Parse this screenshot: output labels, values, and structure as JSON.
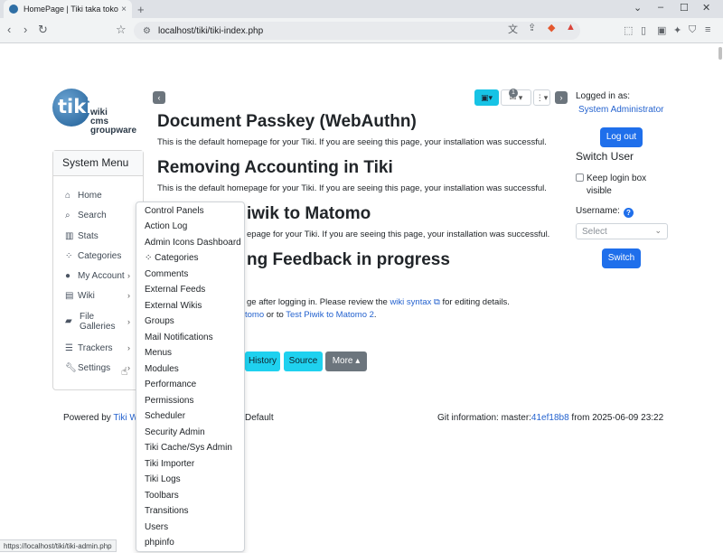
{
  "browser": {
    "tab_title": "HomePage | Tiki taka toko",
    "tab_close": "×",
    "new_tab": "+",
    "url": "localhost/tiki/tiki-index.php",
    "status_url": "https://localhost/tiki/tiki-admin.php",
    "win_min": "–",
    "win_max": "☐",
    "win_close": "✕",
    "chevron": "⌄"
  },
  "logo": {
    "mark": "tiki",
    "line1": "wiki",
    "line2": "cms",
    "line3": "groupware"
  },
  "system_menu": {
    "title": "System Menu",
    "items": [
      {
        "label": "Home",
        "icon": "home-icon"
      },
      {
        "label": "Search",
        "icon": "search-icon"
      },
      {
        "label": "Stats",
        "icon": "chart-icon"
      },
      {
        "label": "Categories",
        "icon": "sitemap-icon"
      },
      {
        "label": "My Account",
        "icon": "user-icon"
      },
      {
        "label": "Wiki",
        "icon": "file-icon"
      },
      {
        "label": "File Galleries",
        "icon": "folder-icon"
      },
      {
        "label": "Trackers",
        "icon": "database-icon"
      },
      {
        "label": "Settings",
        "icon": "wrench-icon"
      }
    ]
  },
  "settings_dropdown": {
    "items": [
      "Control Panels",
      "Action Log",
      "Admin Icons Dashboard",
      "Categories",
      "Comments",
      "External Feeds",
      "External Wikis",
      "Groups",
      "Mail Notifications",
      "Menus",
      "Modules",
      "Performance",
      "Permissions",
      "Scheduler",
      "Security Admin",
      "Tiki Cache/Sys Admin",
      "Tiki Importer",
      "Tiki Logs",
      "Toolbars",
      "Transitions",
      "Users",
      "phpinfo"
    ]
  },
  "main": {
    "toolbar_badge": "1",
    "sections": [
      {
        "title": "Document Passkey (WebAuthn)",
        "text": "This is the default homepage for your Tiki. If you are seeing this page, your installation was successful."
      },
      {
        "title": "Removing Accounting in Tiki",
        "text": "This is the default homepage for your Tiki. If you are seeing this page, your installation was successful."
      },
      {
        "title": "iwik to Matomo",
        "text": "epage for your Tiki. If you are seeing this page, your installation was successful."
      },
      {
        "title": "ng Feedback in progress",
        "text": "ge after logging in. Please review the"
      }
    ],
    "wiki_syntax_link": "wiki syntax",
    "after_link": " for editing details.",
    "line5_a": "tomo",
    "line5_b": " or to ",
    "line5_link": "Test Piwik to Matomo 2",
    "line5_end": ".",
    "buttons": {
      "history": "History",
      "source": "Source",
      "more": "More ▴"
    }
  },
  "footer": {
    "powered_by": "Powered by ",
    "tiki_link": "Tiki Wi",
    "theme": "Default",
    "git_label": "Git information:  master:",
    "git_hash": "41ef18b8",
    "git_date": "  from 2025-06-09 23:22"
  },
  "user_panel": {
    "logged_in_as": "Logged in as:",
    "user": "System Administrator",
    "logout": "Log out",
    "switch_user": "Switch User",
    "keep_login": "Keep login box visible",
    "username_label": "Username:",
    "select_placeholder": "Select",
    "switch_button": "Switch"
  },
  "colors": {
    "primary": "#1f6feb",
    "info": "#1fd1ef",
    "secondary": "#6c757d",
    "link": "#2563cf"
  }
}
